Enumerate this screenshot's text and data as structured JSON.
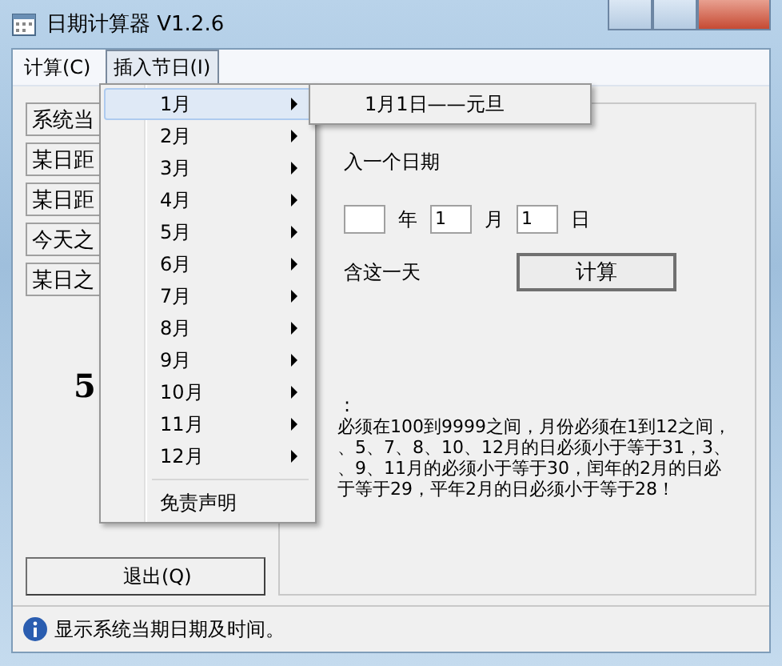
{
  "window": {
    "title": "日期计算器  V1.2.6"
  },
  "menubar": [
    {
      "label": "计算(C)",
      "selected": false
    },
    {
      "label": "插入节日(I)",
      "selected": true
    }
  ],
  "left_buttons": [
    "系统当",
    "某日距",
    "某日距",
    "今天之",
    "某日之"
  ],
  "result_label": "5",
  "exit_button": "退出(Q)",
  "panel": {
    "prompt": "入一个日期",
    "date": [
      {
        "kind": "field"
      },
      {
        "kind": "text",
        "value": "年"
      },
      {
        "kind": "field",
        "value": "1"
      },
      {
        "kind": "text",
        "value": "月"
      },
      {
        "kind": "field",
        "value": "1"
      },
      {
        "kind": "text",
        "value": "日"
      }
    ],
    "include_label": "含这一天",
    "calc_button": "计算",
    "note_head": ":",
    "note_lines": [
      "必须在100到9999之间，月份必须在1到12之间，",
      "、5、7、8、10、12月的日必须小于等于31，3、",
      "、9、11月的必须小于等于30，闰年的2月的日必",
      "于等于29，平年2月的日必须小于等于28！"
    ]
  },
  "status_bar": {
    "text": "显示系统当期日期及时间。"
  },
  "menu": {
    "items": [
      {
        "kind": "submenu",
        "label": "1月",
        "selected": true
      },
      {
        "kind": "submenu",
        "label": "2月",
        "selected": false
      },
      {
        "kind": "submenu",
        "label": "3月",
        "selected": false
      },
      {
        "kind": "submenu",
        "label": "4月",
        "selected": false
      },
      {
        "kind": "submenu",
        "label": "5月",
        "selected": false
      },
      {
        "kind": "submenu",
        "label": "6月",
        "selected": false
      },
      {
        "kind": "submenu",
        "label": "7月",
        "selected": false
      },
      {
        "kind": "submenu",
        "label": "8月",
        "selected": false
      },
      {
        "kind": "submenu",
        "label": "9月",
        "selected": false
      },
      {
        "kind": "submenu",
        "label": "10月",
        "selected": false
      },
      {
        "kind": "submenu",
        "label": "11月",
        "selected": false
      },
      {
        "kind": "submenu",
        "label": "12月",
        "selected": false
      },
      {
        "kind": "separator"
      },
      {
        "kind": "item",
        "label": "免责声明",
        "selected": false
      }
    ],
    "submenu": [
      "1月1日——元旦"
    ]
  }
}
